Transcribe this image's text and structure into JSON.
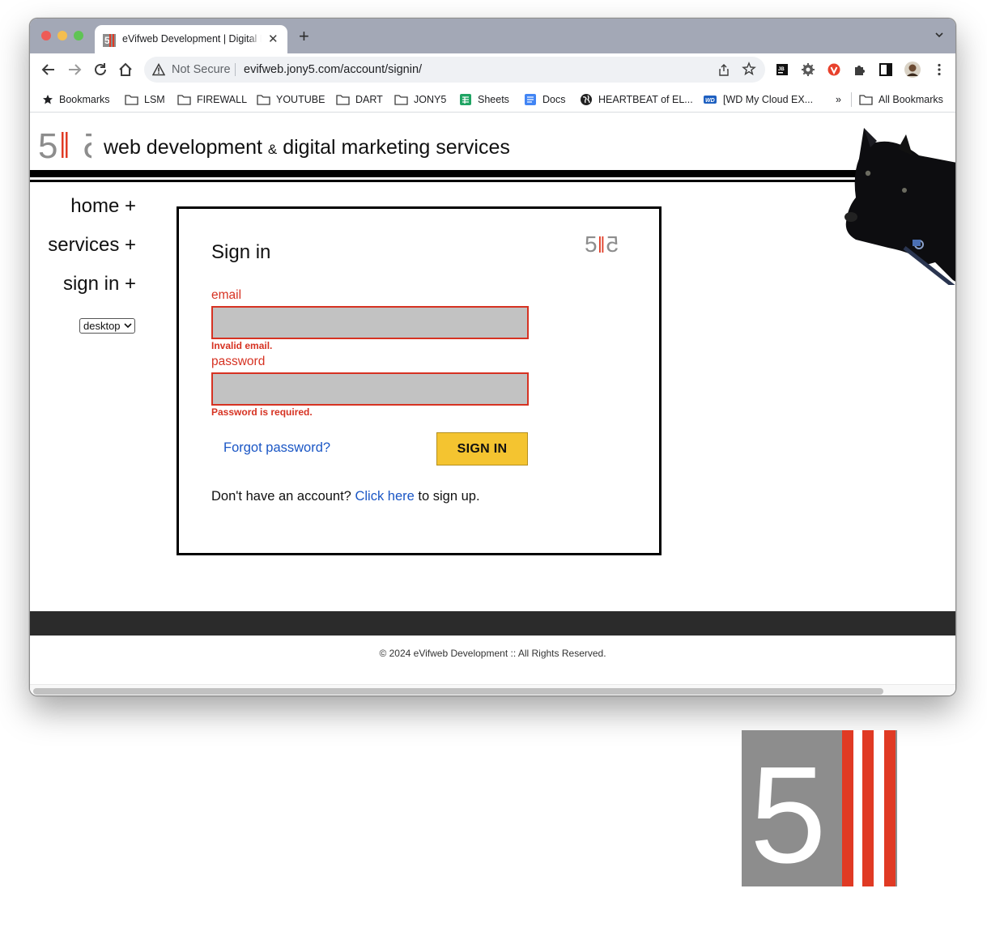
{
  "browser": {
    "tab_title": "eVifweb Development | Digital Marketing",
    "new_tab_label": "+",
    "close_label": "✕",
    "security_status": "Not Secure",
    "url": "evifweb.jony5.com/account/signin/",
    "bookmarks": [
      {
        "label": "Bookmarks",
        "icon": "star-icon"
      },
      {
        "label": "LSM",
        "icon": "folder-icon"
      },
      {
        "label": "FIREWALL",
        "icon": "folder-icon"
      },
      {
        "label": "YOUTUBE",
        "icon": "folder-icon"
      },
      {
        "label": "DART",
        "icon": "folder-icon"
      },
      {
        "label": "JONY5",
        "icon": "folder-icon"
      },
      {
        "label": "Sheets",
        "icon": "sheets-icon"
      },
      {
        "label": "Docs",
        "icon": "docs-icon"
      },
      {
        "label": "HEARTBEAT of EL...",
        "icon": "globe-icon"
      },
      {
        "label": "[WD My Cloud EX...",
        "icon": "wd-icon"
      }
    ],
    "bookmarks_overflow": "»",
    "all_bookmarks": "All Bookmarks"
  },
  "site": {
    "tagline_part1": "web development",
    "tagline_amp": "&",
    "tagline_part2": "digital marketing services",
    "nav": [
      {
        "label": "home +"
      },
      {
        "label": "services +"
      },
      {
        "label": "sign in +"
      }
    ],
    "view_select": "desktop",
    "footer_copy": "© 2024 eVifweb Development :: All Rights Reserved."
  },
  "signin": {
    "title": "Sign in",
    "email_label": "email",
    "email_value": "",
    "email_error": "Invalid email.",
    "password_label": "password",
    "password_value": "",
    "password_error": "Password is required.",
    "forgot_link": "Forgot password?",
    "submit_label": "SIGN IN",
    "signup_prefix": "Don't have an account?",
    "signup_link": "Click here",
    "signup_suffix": "to sign up."
  },
  "colors": {
    "error": "#d63222",
    "link": "#1a56c5",
    "button": "#f4c430",
    "logo_gray": "#8d8d8d",
    "logo_red": "#e03a24"
  }
}
